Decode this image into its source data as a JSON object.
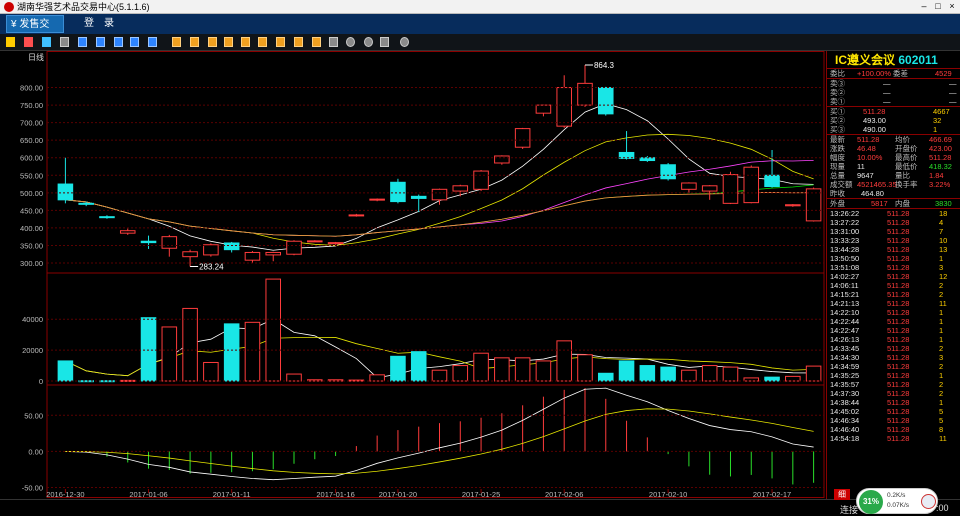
{
  "window": {
    "title": "湖南华强艺术品交易中心(5.1.1.6)",
    "minimize": "–",
    "maximize": "□",
    "close": "×"
  },
  "menu": {
    "tabs": [
      {
        "label": "¥ 发售交易",
        "active": true
      },
      {
        "label": "登　录",
        "active": false
      }
    ]
  },
  "chart": {
    "period_label": "日线",
    "max_label": "864.3",
    "min_label": "283.24",
    "price_ticks": [
      "800.00",
      "750.00",
      "700.00",
      "650.00",
      "600.00",
      "550.00",
      "500.00",
      "450.00",
      "400.00",
      "350.00",
      "300.00"
    ],
    "volume_ticks": [
      "40000",
      "20000",
      "0"
    ],
    "macd_ticks": [
      "50.00",
      "0.00",
      "-50.00"
    ],
    "date_ticks": [
      "2016-12-30",
      "2017-01-06",
      "2017-01-11",
      "2017-01-16",
      "2017-01-20",
      "2017-01-25",
      "2017-02-06",
      "2017-02-10",
      "2017-02-17"
    ],
    "colors": {
      "up": "#ff3c3c",
      "down": "#19e6e6",
      "ma5": "#ffffff",
      "ma10": "#e6e600",
      "ma20": "#ff44ff",
      "ma30": "#00dd00",
      "ma60": "#ff8844"
    }
  },
  "chart_data": {
    "type": "candlestick",
    "candles": [
      {
        "o": 525,
        "c": 480,
        "h": 600,
        "l": 470,
        "v": 13000
      },
      {
        "o": 470,
        "c": 468,
        "h": 475,
        "l": 462,
        "v": 200
      },
      {
        "o": 432,
        "c": 430,
        "h": 436,
        "l": 426,
        "v": 200
      },
      {
        "o": 385,
        "c": 392,
        "h": 398,
        "l": 380,
        "v": 400
      },
      {
        "o": 362,
        "c": 358,
        "h": 378,
        "l": 340,
        "v": 41000
      },
      {
        "o": 342,
        "c": 375,
        "h": 380,
        "l": 318,
        "v": 35000
      },
      {
        "o": 318,
        "c": 332,
        "h": 338,
        "l": 290,
        "v": 47000
      },
      {
        "o": 323,
        "c": 352,
        "h": 356,
        "l": 318,
        "v": 12000
      },
      {
        "o": 357,
        "c": 338,
        "h": 360,
        "l": 330,
        "v": 37000
      },
      {
        "o": 308,
        "c": 330,
        "h": 334,
        "l": 300,
        "v": 38000
      },
      {
        "o": 323,
        "c": 330,
        "h": 332,
        "l": 305,
        "v": 66000
      },
      {
        "o": 325,
        "c": 362,
        "h": 365,
        "l": 322,
        "v": 4500
      },
      {
        "o": 362,
        "c": 363,
        "h": 365,
        "l": 360,
        "v": 800
      },
      {
        "o": 355,
        "c": 358,
        "h": 360,
        "l": 352,
        "v": 800
      },
      {
        "o": 435,
        "c": 437,
        "h": 440,
        "l": 432,
        "v": 600
      },
      {
        "o": 480,
        "c": 482,
        "h": 484,
        "l": 476,
        "v": 4000
      },
      {
        "o": 530,
        "c": 475,
        "h": 540,
        "l": 470,
        "v": 16000
      },
      {
        "o": 490,
        "c": 484,
        "h": 495,
        "l": 445,
        "v": 19000
      },
      {
        "o": 480,
        "c": 510,
        "h": 512,
        "l": 466,
        "v": 7000
      },
      {
        "o": 505,
        "c": 520,
        "h": 523,
        "l": 490,
        "v": 10000
      },
      {
        "o": 510,
        "c": 562,
        "h": 565,
        "l": 505,
        "v": 18000
      },
      {
        "o": 585,
        "c": 605,
        "h": 607,
        "l": 580,
        "v": 15000
      },
      {
        "o": 630,
        "c": 683,
        "h": 685,
        "l": 625,
        "v": 15000
      },
      {
        "o": 727,
        "c": 750,
        "h": 752,
        "l": 718,
        "v": 13000
      },
      {
        "o": 690,
        "c": 800,
        "h": 835,
        "l": 685,
        "v": 26000
      },
      {
        "o": 750,
        "c": 812,
        "h": 864.3,
        "l": 745,
        "v": 17000
      },
      {
        "o": 800,
        "c": 725,
        "h": 802,
        "l": 720,
        "v": 5000
      },
      {
        "o": 615,
        "c": 598,
        "h": 676,
        "l": 595,
        "v": 13000
      },
      {
        "o": 600,
        "c": 592,
        "h": 605,
        "l": 588,
        "v": 10000
      },
      {
        "o": 580,
        "c": 540,
        "h": 585,
        "l": 535,
        "v": 9000
      },
      {
        "o": 510,
        "c": 528,
        "h": 530,
        "l": 500,
        "v": 7000
      },
      {
        "o": 505,
        "c": 520,
        "h": 522,
        "l": 480,
        "v": 10000
      },
      {
        "o": 470,
        "c": 552,
        "h": 560,
        "l": 468,
        "v": 9000
      },
      {
        "o": 472,
        "c": 573,
        "h": 578,
        "l": 470,
        "v": 2000
      },
      {
        "o": 550,
        "c": 518,
        "h": 622,
        "l": 515,
        "v": 2500
      },
      {
        "o": 463,
        "c": 466,
        "h": 468,
        "l": 460,
        "v": 3000
      },
      {
        "o": 420,
        "c": 511.28,
        "h": 515,
        "l": 418,
        "v": 9647
      }
    ],
    "price_range": [
      280,
      870
    ],
    "volume_range": [
      0,
      68000
    ],
    "macd_range": [
      -52,
      85
    ]
  },
  "quote": {
    "name": "IC遵义会议",
    "code": "602011",
    "weibi_label": "委比",
    "weibi_value": "+100.00%",
    "weicha_label": "委差",
    "weicha_value": "4529",
    "asks": [
      {
        "label": "卖③",
        "price": "—",
        "vol": "—"
      },
      {
        "label": "卖②",
        "price": "—",
        "vol": "—"
      },
      {
        "label": "卖①",
        "price": "—",
        "vol": "—"
      }
    ],
    "bids": [
      {
        "label": "买①",
        "price": "511.28",
        "vol": "4667"
      },
      {
        "label": "买②",
        "price": "493.00",
        "vol": "32"
      },
      {
        "label": "买③",
        "price": "490.00",
        "vol": "1"
      }
    ],
    "stats": [
      {
        "l1": "最新",
        "v1": "511.28",
        "l2": "均价",
        "v2": "466.69"
      },
      {
        "l1": "涨跌",
        "v1": "46.48",
        "l2": "开盘价",
        "v2": "423.00"
      },
      {
        "l1": "幅度",
        "v1": "10.00%",
        "l2": "最高价",
        "v2": "511.28"
      },
      {
        "l1": "现量",
        "v1": "11",
        "l2": "最低价",
        "v2": "418.32"
      },
      {
        "l1": "总量",
        "v1": "9647",
        "l2": "量比",
        "v2": "1.84"
      },
      {
        "l1": "成交额",
        "v1": "4521465.35",
        "l2": "换手率",
        "v2": "3.22%"
      }
    ],
    "prev_close_label": "昨收",
    "prev_close": "464.80",
    "outer_label": "外盘",
    "outer": "5817",
    "inner_label": "内盘",
    "inner": "3830",
    "ticks": [
      {
        "t": "13:26:22",
        "p": "511.28",
        "v": "18"
      },
      {
        "t": "13:27:22",
        "p": "511.28",
        "v": "4"
      },
      {
        "t": "13:31:00",
        "p": "511.28",
        "v": "7"
      },
      {
        "t": "13:33:23",
        "p": "511.28",
        "v": "10"
      },
      {
        "t": "13:44:28",
        "p": "511.28",
        "v": "13"
      },
      {
        "t": "13:50:50",
        "p": "511.28",
        "v": "1"
      },
      {
        "t": "13:51:08",
        "p": "511.28",
        "v": "3"
      },
      {
        "t": "14:02:27",
        "p": "511.28",
        "v": "12"
      },
      {
        "t": "14:06:11",
        "p": "511.28",
        "v": "2"
      },
      {
        "t": "14:15:21",
        "p": "511.28",
        "v": "2"
      },
      {
        "t": "14:21:13",
        "p": "511.28",
        "v": "11"
      },
      {
        "t": "14:22:10",
        "p": "511.28",
        "v": "1"
      },
      {
        "t": "14:22:44",
        "p": "511.28",
        "v": "1"
      },
      {
        "t": "14:22:47",
        "p": "511.28",
        "v": "1"
      },
      {
        "t": "14:26:13",
        "p": "511.28",
        "v": "1"
      },
      {
        "t": "14:33:45",
        "p": "511.28",
        "v": "2"
      },
      {
        "t": "14:34:30",
        "p": "511.28",
        "v": "3"
      },
      {
        "t": "14:34:59",
        "p": "511.28",
        "v": "2"
      },
      {
        "t": "14:35:25",
        "p": "511.28",
        "v": "1"
      },
      {
        "t": "14:35:57",
        "p": "511.28",
        "v": "2"
      },
      {
        "t": "14:37:30",
        "p": "511.28",
        "v": "2"
      },
      {
        "t": "14:38:44",
        "p": "511.28",
        "v": "1"
      },
      {
        "t": "14:45:02",
        "p": "511.28",
        "v": "5"
      },
      {
        "t": "14:46:34",
        "p": "511.28",
        "v": "5"
      },
      {
        "t": "14:46:40",
        "p": "511.28",
        "v": "8"
      },
      {
        "t": "14:54:18",
        "p": "511.28",
        "v": "11"
      }
    ]
  },
  "status": {
    "tab_label": "细",
    "conn_label": "连接",
    "clock": ":00"
  },
  "widget": {
    "percent": "31%",
    "up_speed": "0.2K/s",
    "down_speed": "0.07K/s"
  }
}
